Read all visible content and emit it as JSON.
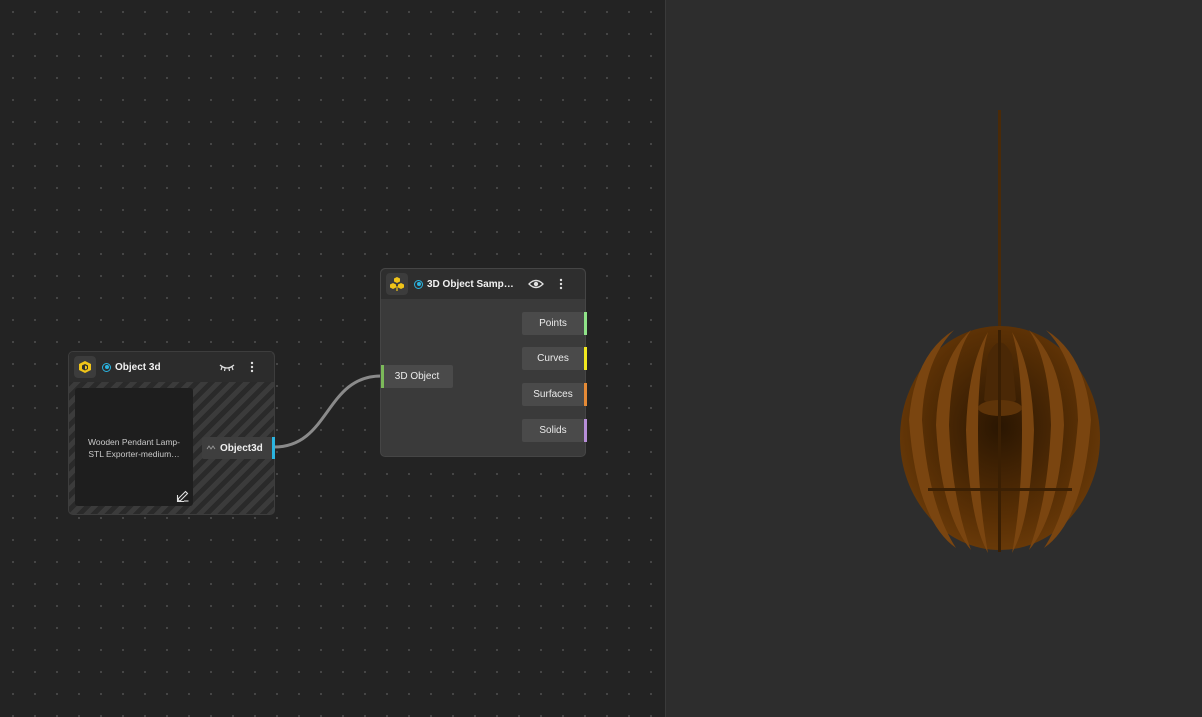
{
  "colors": {
    "canvas_bg": "#232323",
    "viewport_bg": "#2d2d2d",
    "accent_cyan": "#2ab4e0",
    "port_points": "#8fe388",
    "port_curves": "#f1e81f",
    "port_surfaces": "#e58a36",
    "port_solids": "#b78ed8",
    "port_input": "#7cba5a",
    "lamp_wood": "#6b3a08"
  },
  "object3d_node": {
    "title": "Object 3d",
    "logo_icon": "cube-icon",
    "visibility_icon": "eye-closed-icon",
    "menu_icon": "more-vertical-icon",
    "preview_text": "Wooden Pendant Lamp-STL Exporter-medium…",
    "edit_icon": "pencil-icon",
    "output_icon": "object3d-type-icon",
    "output_label": "Object3d"
  },
  "sampler_node": {
    "title": "3D Object Samp…",
    "logo_icon": "cubes-icon",
    "visibility_icon": "eye-icon",
    "menu_icon": "more-vertical-icon",
    "input_label": "3D Object",
    "outputs": [
      {
        "label": "Points"
      },
      {
        "label": "Curves"
      },
      {
        "label": "Surfaces"
      },
      {
        "label": "Solids"
      }
    ]
  },
  "viewport": {
    "model": "wooden-pendant-lamp"
  }
}
